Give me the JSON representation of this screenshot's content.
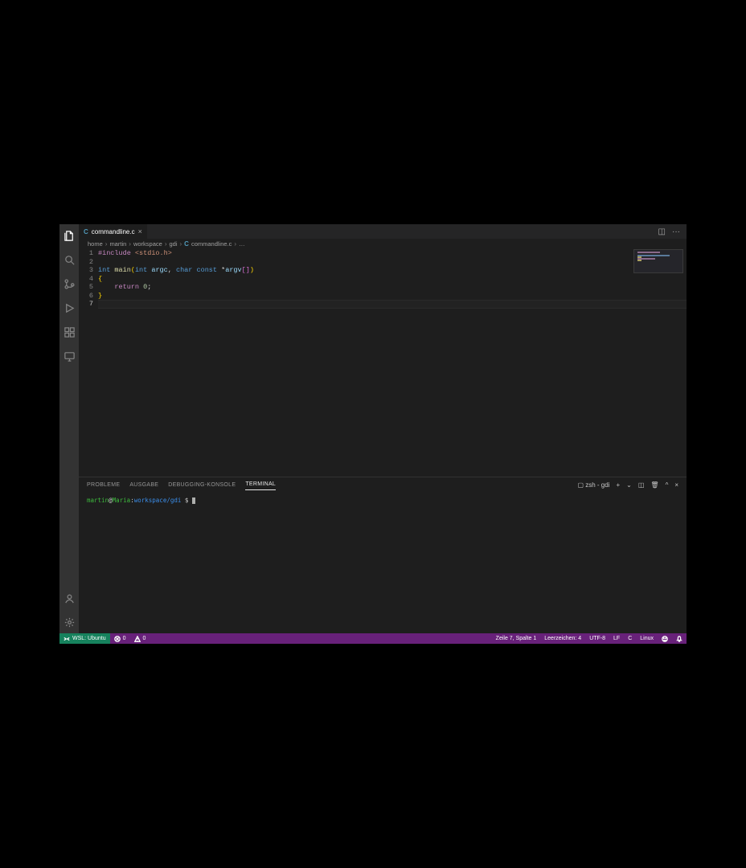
{
  "tab": {
    "filename": "commandline.c",
    "icon": "C"
  },
  "breadcrumb": {
    "seg1": "home",
    "seg2": "martin",
    "seg3": "workspace",
    "seg4": "gdi",
    "fileIcon": "C",
    "file": "commandline.c",
    "more": "…"
  },
  "code": {
    "lines": [
      "1",
      "2",
      "3",
      "4",
      "5",
      "6",
      "7"
    ],
    "l1": {
      "include": "#include",
      "hdr": "<stdio.h>"
    },
    "l3": {
      "int": "int",
      "main": "main",
      "open": "(",
      "int2": "int",
      "argc": "argc",
      "comma": ",",
      "char": "char",
      "const": "const",
      "star": "*",
      "argv": "argv",
      "br1": "[",
      "br2": "]",
      "close": ")"
    },
    "l4": {
      "brace": "{"
    },
    "l5": {
      "ret": "return",
      "zero": "0",
      "semi": ";"
    },
    "l6": {
      "brace": "}"
    }
  },
  "panel": {
    "tabs": {
      "probleme": "PROBLEME",
      "ausgabe": "AUSGABE",
      "debug": "DEBUGGING-KONSOLE",
      "terminal": "TERMINAL"
    },
    "zsh": "zsh - gdi",
    "plus": "+"
  },
  "terminal": {
    "user": "martin",
    "at": "@",
    "host": "Maria",
    "colon": ":",
    "path": "workspace/gdi",
    "prompt": " $ "
  },
  "status": {
    "remote": "WSL: Ubuntu",
    "errors": "0",
    "warnings": "0",
    "cursor": "Zeile 7, Spalte 1",
    "indent": "Leerzeichen: 4",
    "encoding": "UTF-8",
    "eol": "LF",
    "lang": "C",
    "os": "Linux"
  }
}
